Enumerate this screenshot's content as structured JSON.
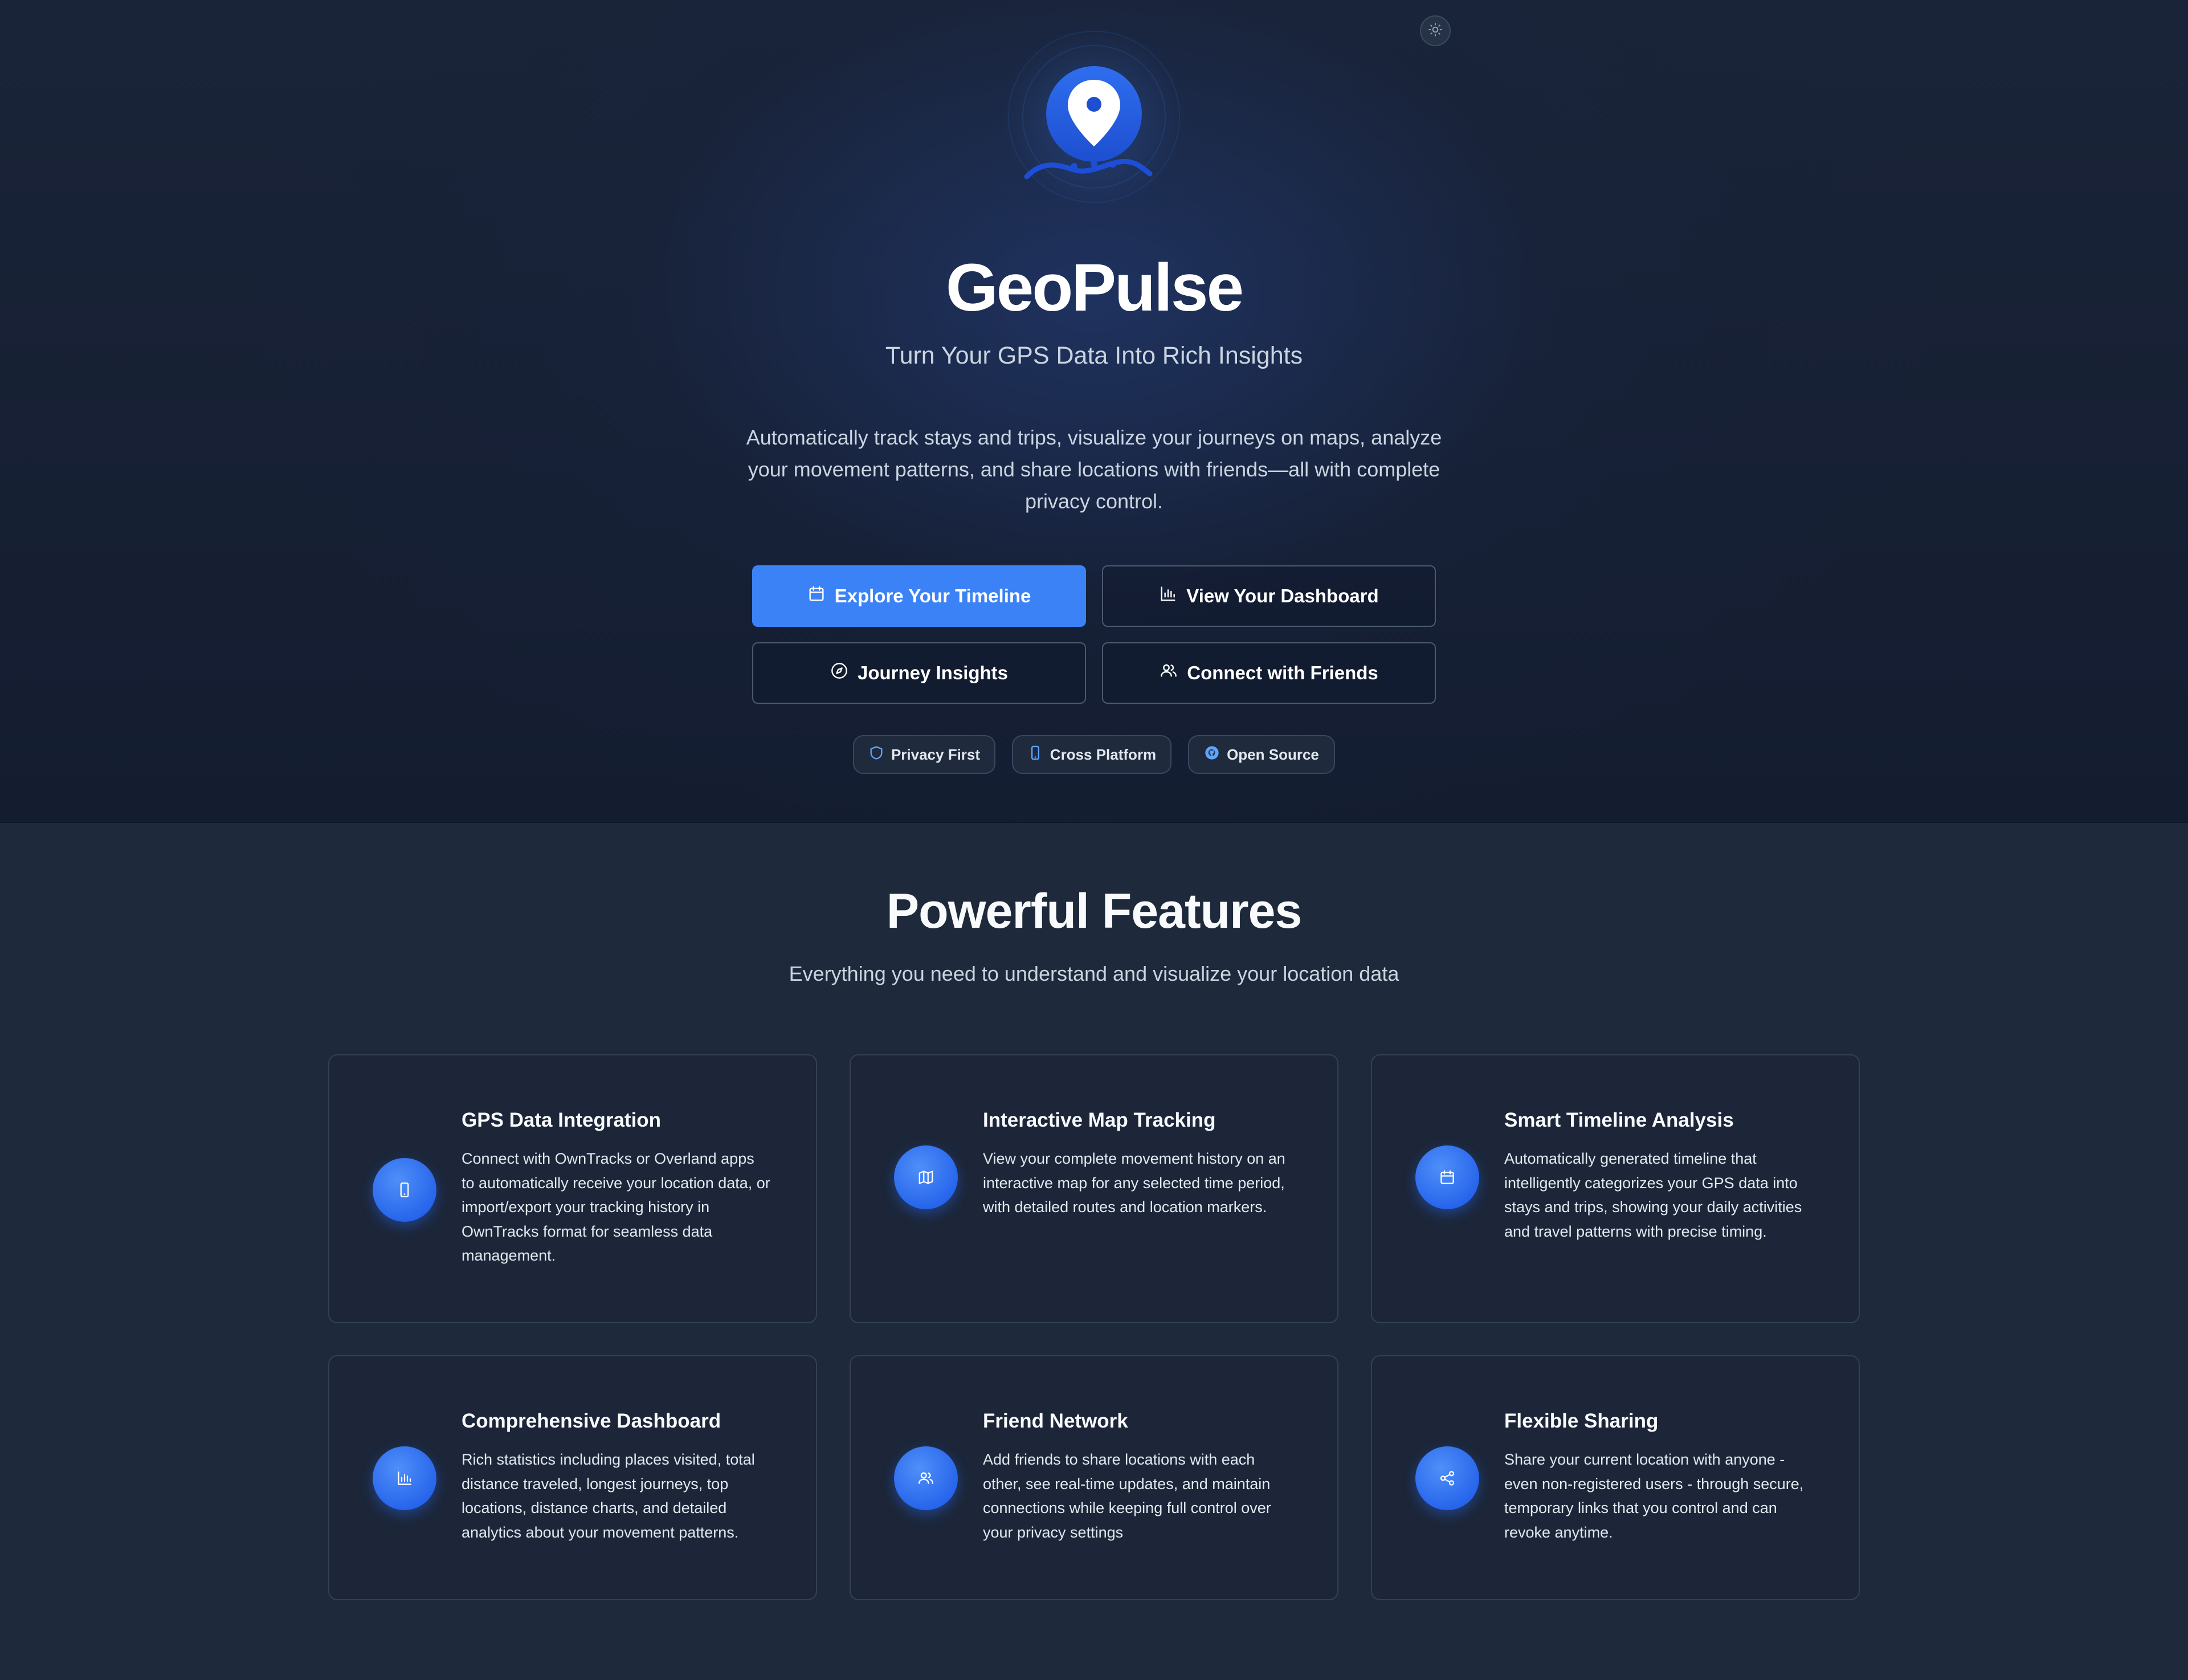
{
  "hero": {
    "title": "GeoPulse",
    "tagline": "Turn Your GPS Data Into Rich Insights",
    "description": "Automatically track stays and trips, visualize your journeys on maps, analyze your movement patterns, and share locations with friends—all with complete privacy control.",
    "buttons": [
      {
        "label": "Explore Your Timeline",
        "icon": "calendar-icon"
      },
      {
        "label": "View Your Dashboard",
        "icon": "bar-chart-icon"
      },
      {
        "label": "Journey Insights",
        "icon": "compass-icon"
      },
      {
        "label": "Connect with Friends",
        "icon": "users-icon"
      }
    ],
    "badges": [
      {
        "label": "Privacy First",
        "icon": "shield-icon"
      },
      {
        "label": "Cross Platform",
        "icon": "mobile-icon"
      },
      {
        "label": "Open Source",
        "icon": "github-icon"
      }
    ],
    "theme_toggle_icon": "sun-icon"
  },
  "features": {
    "title": "Powerful Features",
    "subtitle": "Everything you need to understand and visualize your location data",
    "cards": [
      {
        "title": "GPS Data Integration",
        "text": "Connect with OwnTracks or Overland apps to automatically receive your location data, or import/export your tracking history in OwnTracks format for seamless data management.",
        "icon": "mobile-icon"
      },
      {
        "title": "Interactive Map Tracking",
        "text": "View your complete movement history on an interactive map for any selected time period, with detailed routes and location markers.",
        "icon": "map-icon"
      },
      {
        "title": "Smart Timeline Analysis",
        "text": "Automatically generated timeline that intelligently categorizes your GPS data into stays and trips, showing your daily activities and travel patterns with precise timing.",
        "icon": "calendar-icon"
      },
      {
        "title": "Comprehensive Dashboard",
        "text": "Rich statistics including places visited, total distance traveled, longest journeys, top locations, distance charts, and detailed analytics about your movement patterns.",
        "icon": "bar-chart-icon"
      },
      {
        "title": "Friend Network",
        "text": "Add friends to share locations with each other, see real-time updates, and maintain connections while keeping full control over your privacy settings",
        "icon": "users-icon"
      },
      {
        "title": "Flexible Sharing",
        "text": "Share your current location with anyone - even non-registered users - through secure, temporary links that you control and can revoke anytime.",
        "icon": "share-icon"
      }
    ]
  },
  "colors": {
    "accent": "#3b82f6",
    "hero_bg": "#141d30",
    "section_bg": "#1e293b",
    "card_border": "#334155"
  }
}
